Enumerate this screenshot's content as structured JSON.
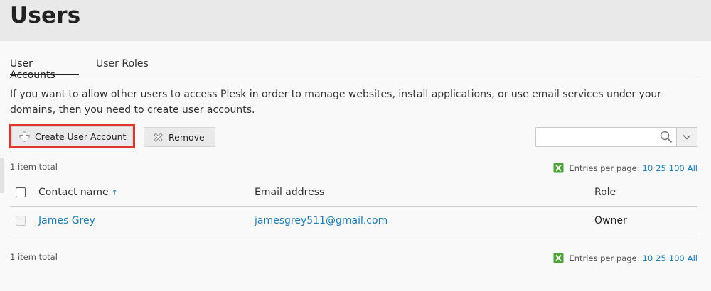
{
  "page": {
    "title": "Users"
  },
  "tabs": [
    {
      "label": "User Accounts",
      "active": true
    },
    {
      "label": "User Roles",
      "active": false
    }
  ],
  "intro_text": "If you want to allow other users to access Plesk in order to manage websites, install applications, or use email services under your domains, then you need to create user accounts.",
  "toolbar": {
    "create_label": "Create User Account",
    "create_icon": "plus-icon",
    "remove_label": "Remove",
    "remove_icon": "x-icon",
    "highlight_color": "#e0352f"
  },
  "search": {
    "value": "",
    "placeholder": ""
  },
  "list": {
    "total_text": "1 item total",
    "entries_label": "Entries per page:",
    "page_sizes": [
      "10",
      "25",
      "100",
      "All"
    ],
    "columns": {
      "name": "Contact name",
      "name_sort": "↑",
      "email": "Email address",
      "role": "Role"
    },
    "rows": [
      {
        "name": "James Grey",
        "email": "jamesgrey511@gmail.com",
        "role": "Owner",
        "selectable": false
      }
    ]
  },
  "colors": {
    "link": "#1c7cb5",
    "excel_green": "#4fa33a"
  }
}
